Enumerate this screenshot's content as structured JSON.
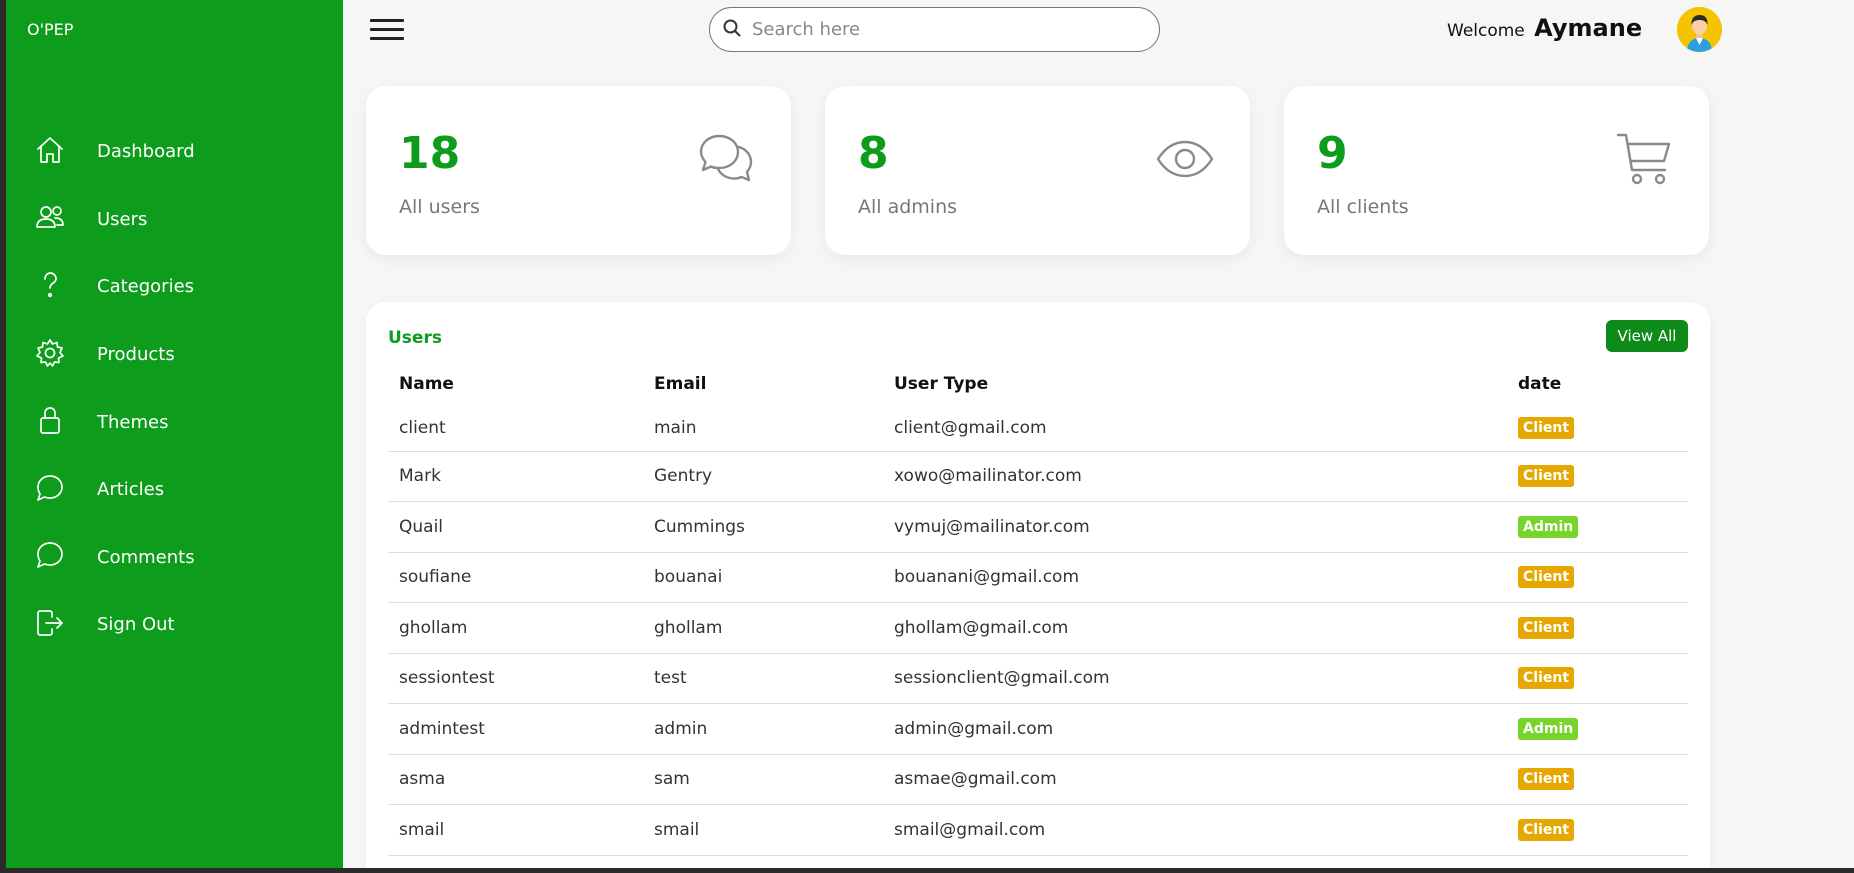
{
  "app": {
    "brand": "O'PEP"
  },
  "colors": {
    "primary": "#0e9c1c",
    "client_badge": "#e6a800",
    "admin_badge": "#76d42b"
  },
  "sidebar": {
    "items": [
      {
        "label": "Dashboard",
        "icon": "home-icon"
      },
      {
        "label": "Users",
        "icon": "users-icon"
      },
      {
        "label": "Categories",
        "icon": "help-icon"
      },
      {
        "label": "Products",
        "icon": "gear-icon"
      },
      {
        "label": "Themes",
        "icon": "lock-icon"
      },
      {
        "label": "Articles",
        "icon": "chat-icon"
      },
      {
        "label": "Comments",
        "icon": "chat-icon"
      },
      {
        "label": "Sign Out",
        "icon": "log-out-icon"
      }
    ]
  },
  "header": {
    "search_placeholder": "Search here",
    "welcome_text": "Welcome",
    "user_name": "Aymane"
  },
  "stats": [
    {
      "value": "18",
      "label": "All users",
      "icon": "chatbubbles-icon"
    },
    {
      "value": "8",
      "label": "All admins",
      "icon": "eye-icon"
    },
    {
      "value": "9",
      "label": "All clients",
      "icon": "cart-icon"
    }
  ],
  "users_panel": {
    "title": "Users",
    "view_all_label": "View All",
    "columns": [
      "Name",
      "Email",
      "User Type",
      "date"
    ],
    "rows": [
      [
        "client",
        "main",
        "client@gmail.com",
        "Client"
      ],
      [
        "Mark",
        "Gentry",
        "xowo@mailinator.com",
        "Client"
      ],
      [
        "Quail",
        "Cummings",
        "vymuj@mailinator.com",
        "Admin"
      ],
      [
        "soufiane",
        "bouanai",
        "bouanani@gmail.com",
        "Client"
      ],
      [
        "ghollam",
        "ghollam",
        "ghollam@gmail.com",
        "Client"
      ],
      [
        "sessiontest",
        "test",
        "sessionclient@gmail.com",
        "Client"
      ],
      [
        "admintest",
        "admin",
        "admin@gmail.com",
        "Admin"
      ],
      [
        "asma",
        "sam",
        "asmae@gmail.com",
        "Client"
      ],
      [
        "smail",
        "smail",
        "smail@gmail.com",
        "Client"
      ]
    ]
  }
}
